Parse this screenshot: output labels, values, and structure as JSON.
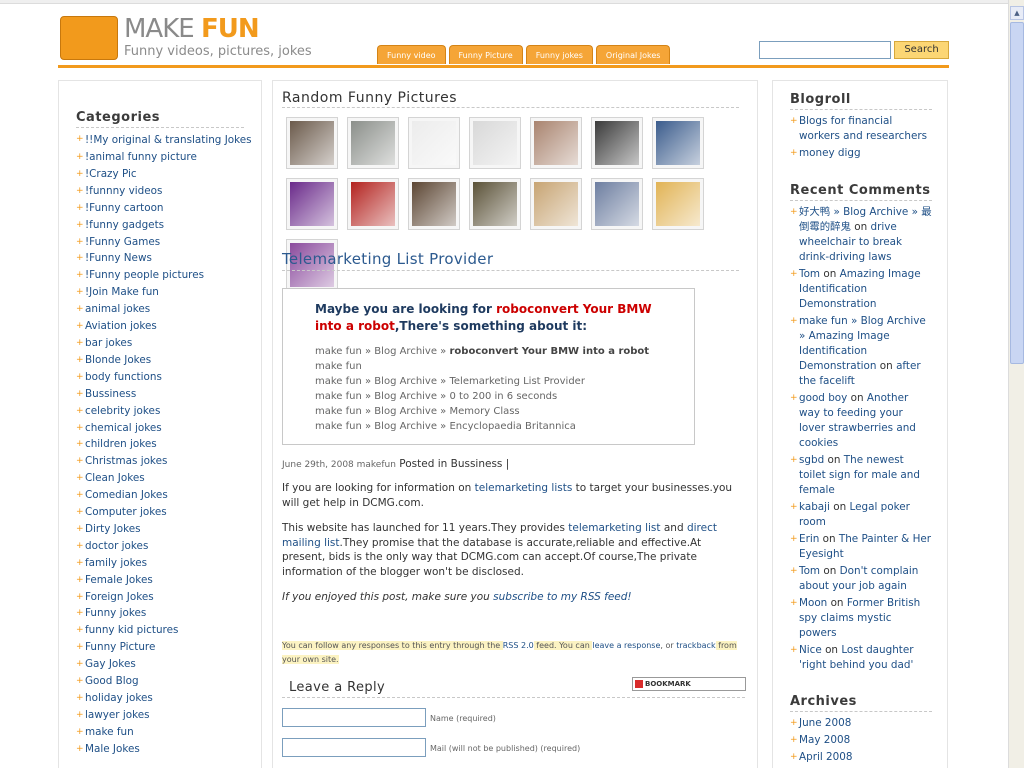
{
  "header": {
    "logo_make": "MAKE",
    "logo_fun": "FUN",
    "tagline": "Funny videos, pictures, jokes",
    "tabs": [
      "Funny video",
      "Funny Picture",
      "Funny jokes",
      "Original Jokes"
    ],
    "search_button": "Search"
  },
  "categories": {
    "title": "Categories",
    "items": [
      "!!My original & translating Jokes",
      "!animal funny picture",
      "!Crazy Pic",
      "!funnny videos",
      "!Funny cartoon",
      "!funny gadgets",
      "!Funny Games",
      "!Funny News",
      "!Funny people pictures",
      "!Join Make fun",
      "animal jokes",
      "Aviation jokes",
      "bar jokes",
      "Blonde Jokes",
      "body functions",
      "Bussiness",
      "celebrity jokes",
      "chemical jokes",
      "children jokes",
      "Christmas jokes",
      "Clean Jokes",
      "Comedian Jokes",
      "Computer jokes",
      "Dirty Jokes",
      "doctor jokes",
      "family jokes",
      "Female Jokes",
      "Foreign Jokes",
      "Funny jokes",
      "funny kid pictures",
      "Funny Picture",
      "Gay Jokes",
      "Good Blog",
      "holiday jokes",
      "lawyer jokes",
      "make fun",
      "Male Jokes"
    ]
  },
  "pictures": {
    "title": "Random Funny Pictures",
    "thumb_colors": [
      "#6b5a4b",
      "#8b8f8a",
      "#ececec",
      "#d8d8d8",
      "#a9846f",
      "#3a3a3a",
      "#3b5c8c",
      "#6a2a8a",
      "#b3231f",
      "#5c4633",
      "#5b5238",
      "#c7a473",
      "#6d7ea0",
      "#e1b355",
      "#8a4a9c"
    ]
  },
  "post": {
    "title": "Telemarketing List Provider",
    "related_intro": "Maybe you are looking for ",
    "related_link": "roboconvert Your BMW into a robot",
    "related_tail": ",There's something about it:",
    "related": [
      {
        "prefix": "make fun » Blog Archive » ",
        "title": "roboconvert Your BMW into a robot",
        "bold": true
      },
      {
        "prefix": "make fun",
        "title": "",
        "bold": false
      },
      {
        "prefix": "make fun » Blog Archive » ",
        "title": "Telemarketing List Provider",
        "bold": false
      },
      {
        "prefix": "make fun » Blog Archive » ",
        "title": "0 to 200 in 6 seconds",
        "bold": false
      },
      {
        "prefix": "make fun » Blog Archive » ",
        "title": "Memory Class",
        "bold": false
      },
      {
        "prefix": "make fun » Blog Archive » ",
        "title": "Encyclopaedia Britannica",
        "bold": false
      }
    ],
    "meta_date": "June 29th, 2008 makefun",
    "meta_posted": " Posted in ",
    "meta_category": "Bussiness",
    "meta_sep": " |",
    "p1_a": "If you are looking for information on ",
    "p1_link": "telemarketing lists",
    "p1_b": " to target your businesses.you will get help in DCMG.com.",
    "p2_a": "This website has launched for 11 years.They provides ",
    "p2_link1": "telemarketing list",
    "p2_and": " and ",
    "p2_link2": "direct mailing list",
    "p2_b": ".They promise that the database is accurate,reliable and effective.At present, bids is the only way that DCMG.com can accept.Of course,The private information of the blogger won't be disclosed.",
    "p3_a": "If you enjoyed this post, make sure you ",
    "p3_link": "subscribe to my RSS feed!",
    "follow_a": "You can follow any responses to this entry through the ",
    "follow_rss": "RSS 2.0",
    "follow_b": " feed. You can ",
    "follow_leave": "leave a response",
    "follow_c": ", or ",
    "follow_trackback": "trackback",
    "follow_d": " from your own site."
  },
  "reply": {
    "title": "Leave a Reply",
    "bookmark": "BOOKMARK",
    "name_label": "Name (required)",
    "mail_label": "Mail (will not be published) (required)"
  },
  "blogroll": {
    "title": "Blogroll",
    "items": [
      "Blogs for financial workers and researchers",
      "money digg"
    ]
  },
  "recent_comments": {
    "title": "Recent Comments",
    "items": [
      {
        "author": "好大鸭 » Blog Archive » 最倒霉的醉鬼",
        "on": " on ",
        "post": "drive wheelchair to break drink-driving laws"
      },
      {
        "author": "Tom",
        "on": " on ",
        "post": "Amazing Image Identification Demonstration"
      },
      {
        "author": "make fun » Blog Archive » Amazing Image Identification Demonstration",
        "on": " on ",
        "post": "after the facelift"
      },
      {
        "author": "good boy",
        "on": " on ",
        "post": "Another way to feeding your lover strawberries and cookies"
      },
      {
        "author": "sgbd",
        "on": " on ",
        "post": "The newest toilet sign for male and female"
      },
      {
        "author": "kabaji",
        "on": " on ",
        "post": "Legal poker room"
      },
      {
        "author": "Erin",
        "on": " on ",
        "post": "The Painter & Her Eyesight"
      },
      {
        "author": "Tom",
        "on": " on ",
        "post": "Don't complain about your job again"
      },
      {
        "author": "Moon",
        "on": " on ",
        "post": "Former British spy claims mystic powers"
      },
      {
        "author": "Nice",
        "on": " on ",
        "post": "Lost daughter 'right behind you dad'"
      }
    ]
  },
  "archives": {
    "title": "Archives",
    "items": [
      "June 2008",
      "May 2008",
      "April 2008"
    ]
  }
}
